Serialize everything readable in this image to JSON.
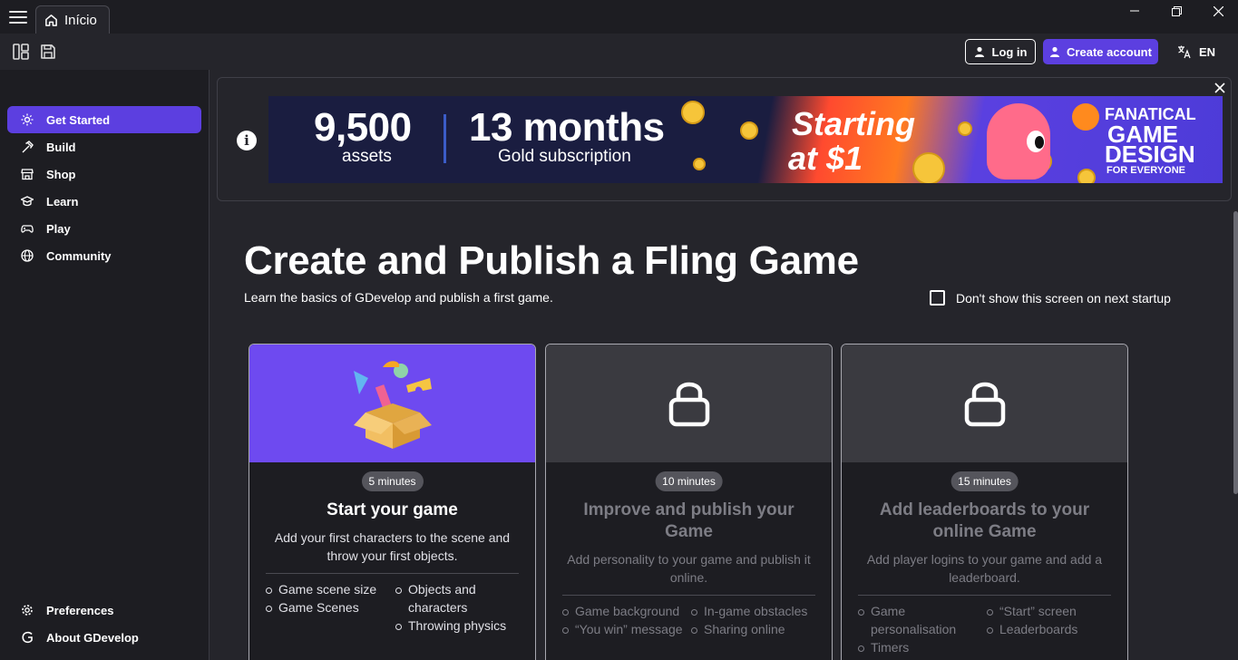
{
  "window": {
    "tab_label": "Início"
  },
  "toolbar": {
    "login_label": "Log in",
    "create_account_label": "Create account",
    "language_label": "EN"
  },
  "sidebar": {
    "items": [
      {
        "label": "Get Started",
        "icon": "sun-icon",
        "active": true
      },
      {
        "label": "Build",
        "icon": "hammer-icon"
      },
      {
        "label": "Shop",
        "icon": "store-icon"
      },
      {
        "label": "Learn",
        "icon": "graduation-cap-icon"
      },
      {
        "label": "Play",
        "icon": "gamepad-icon"
      },
      {
        "label": "Community",
        "icon": "globe-icon"
      }
    ],
    "bottom_items": [
      {
        "label": "Preferences",
        "icon": "gear-icon"
      },
      {
        "label": "About GDevelop",
        "icon": "gdevelop-logo-icon"
      }
    ]
  },
  "banner": {
    "assets_number": "9,500",
    "assets_label": "assets",
    "months_number": "13 months",
    "months_label": "Gold subscription",
    "price_line1": "Starting",
    "price_line2": "at $1",
    "brand_line1": "FANATICAL",
    "brand_line2": "GAME",
    "brand_line3": "DESIGN",
    "brand_line4": "FOR EVERYONE"
  },
  "main": {
    "title": "Create and Publish a Fling Game",
    "subtitle": "Learn the basics of GDevelop and publish a first game.",
    "dont_show_label": "Don't show this screen on next startup"
  },
  "cards": [
    {
      "duration": "5 minutes",
      "title": "Start your game",
      "description": "Add your first characters to the scene and throw your first objects.",
      "list_left": [
        "Game scene size",
        "Game Scenes"
      ],
      "list_right": [
        "Objects and characters",
        "Throwing physics"
      ],
      "locked": false
    },
    {
      "duration": "10 minutes",
      "title": "Improve and publish your Game",
      "description": "Add personality to your game and publish it online.",
      "list_left": [
        "Game background",
        "“You win” message"
      ],
      "list_right": [
        "In-game obstacles",
        "Sharing online"
      ],
      "locked": true
    },
    {
      "duration": "15 minutes",
      "title": "Add leaderboards to your online Game",
      "description": "Add player logins to your game and add a leaderboard.",
      "list_left": [
        "Game personalisation",
        "Timers"
      ],
      "list_right": [
        "“Start” screen",
        "Leaderboards"
      ],
      "locked": true
    }
  ],
  "colors": {
    "accent": "#5c3fe0",
    "card_purple": "#6e4af0",
    "background": "#25252b",
    "sidebar": "#1d1d22"
  }
}
